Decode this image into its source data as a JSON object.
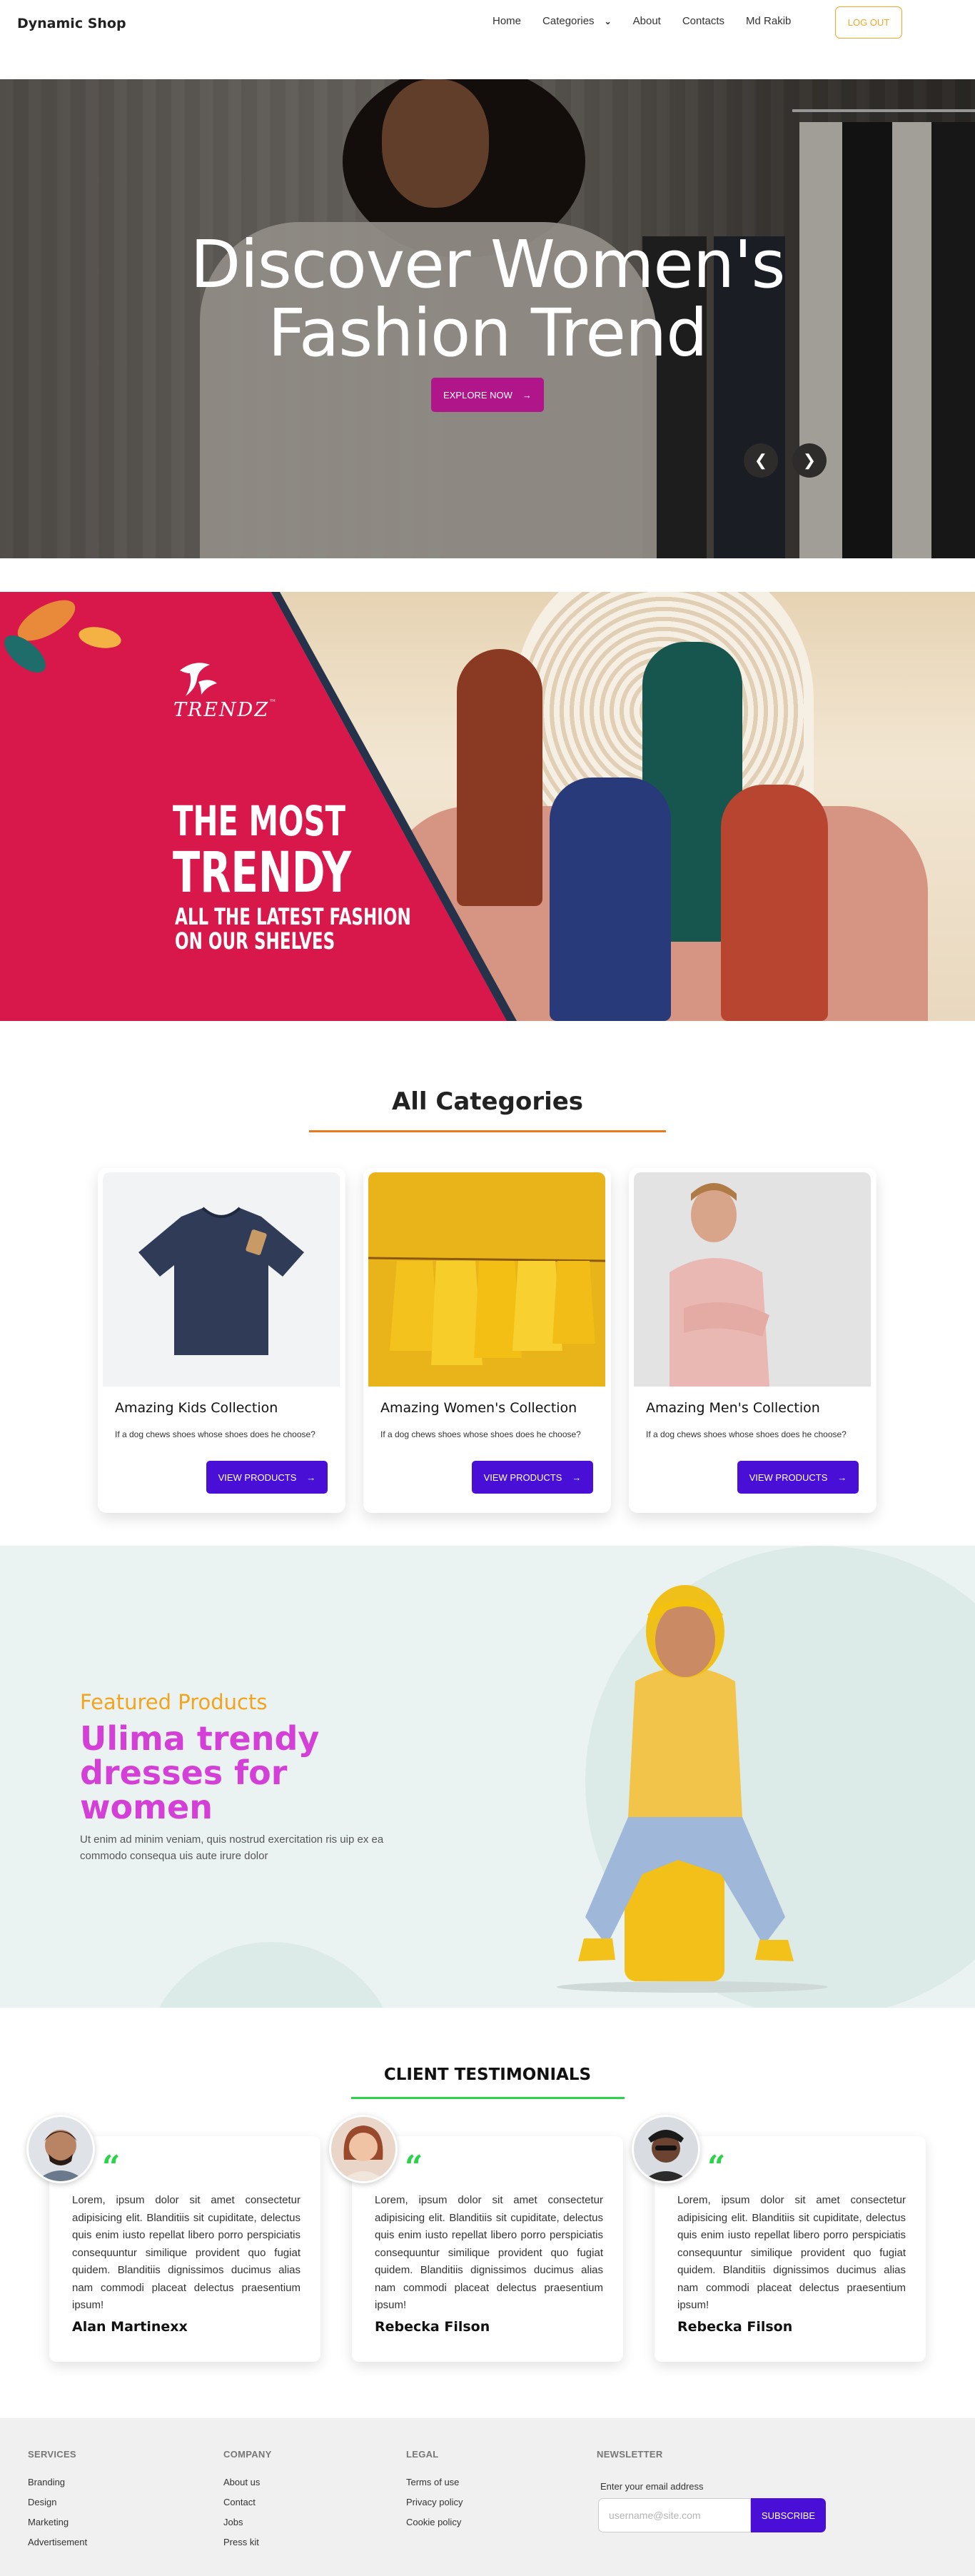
{
  "nav": {
    "brand": "Dynamic Shop",
    "links": [
      "Home",
      "Categories",
      "About",
      "Contacts",
      "Md Rakib"
    ],
    "logout": "LOG OUT"
  },
  "hero": {
    "title_line1": "Discover Women's",
    "title_line2": "Fashion Trend",
    "button": "EXPLORE NOW",
    "prev": "❮",
    "next": "❯"
  },
  "promo": {
    "logo_text": "TRENDZ",
    "logo_tm": "™",
    "headline_line1": "THE MOST",
    "headline_line2": "TRENDY",
    "sub_line1": "ALL THE LATEST FASHION",
    "sub_line2": "ON OUR SHELVES"
  },
  "categories": {
    "title": "All Categories",
    "cards": [
      {
        "title": "Amazing Kids Collection",
        "desc": "If a dog chews shoes whose shoes does he choose?",
        "button": "VIEW PRODUCTS"
      },
      {
        "title": "Amazing Women's Collection",
        "desc": "If a dog chews shoes whose shoes does he choose?",
        "button": "VIEW PRODUCTS"
      },
      {
        "title": "Amazing Men's Collection",
        "desc": "If a dog chews shoes whose shoes does he choose?",
        "button": "VIEW PRODUCTS"
      }
    ]
  },
  "featured": {
    "eyebrow": "Featured Products",
    "title": "Ulima trendy dresses for women",
    "text": "Ut enim ad minim veniam, quis nostrud exercitation ris uip ex ea commodo consequa uis aute irure dolor"
  },
  "testimonials": {
    "title": "CLIENT TESTIMONIALS",
    "quote_mark": "“",
    "items": [
      {
        "text": "Lorem, ipsum dolor sit amet consectetur adipisicing elit. Blanditiis sit cupiditate, delectus quis enim iusto repellat libero porro perspiciatis consequuntur similique provident quo fugiat quidem. Blanditiis dignissimos ducimus alias nam commodi placeat delectus praesentium ipsum!",
        "name": "Alan Martinexx"
      },
      {
        "text": "Lorem, ipsum dolor sit amet consectetur adipisicing elit. Blanditiis sit cupiditate, delectus quis enim iusto repellat libero porro perspiciatis consequuntur similique provident quo fugiat quidem. Blanditiis dignissimos ducimus alias nam commodi placeat delectus praesentium ipsum!",
        "name": "Rebecka Filson"
      },
      {
        "text": "Lorem, ipsum dolor sit amet consectetur adipisicing elit. Blanditiis sit cupiditate, delectus quis enim iusto repellat libero porro perspiciatis consequuntur similique provident quo fugiat quidem. Blanditiis dignissimos ducimus alias nam commodi placeat delectus praesentium ipsum!",
        "name": "Rebecka Filson"
      }
    ]
  },
  "footer": {
    "services": {
      "heading": "SERVICES",
      "links": [
        "Branding",
        "Design",
        "Marketing",
        "Advertisement"
      ]
    },
    "company": {
      "heading": "COMPANY",
      "links": [
        "About us",
        "Contact",
        "Jobs",
        "Press kit"
      ]
    },
    "legal": {
      "heading": "LEGAL",
      "links": [
        "Terms of use",
        "Privacy policy",
        "Cookie policy"
      ]
    },
    "newsletter": {
      "heading": "NEWSLETTER",
      "label": "Enter your email address",
      "placeholder": "username@site.com",
      "button": "SUBSCRIBE"
    }
  },
  "colors": {
    "accent_purple": "#4a0fd6",
    "hero_button": "#b0158a",
    "featured_title": "#d43fd8",
    "featured_eyebrow": "#f2a41f",
    "category_underline": "#e87a1e",
    "testimonial_accent": "#2bd34b",
    "promo_red": "#d8174a",
    "logout_border": "#f5a623"
  },
  "icons": {
    "arrow": "arrow-right-icon",
    "chevron": "chevron-down-icon",
    "quote": "quote-icon"
  }
}
